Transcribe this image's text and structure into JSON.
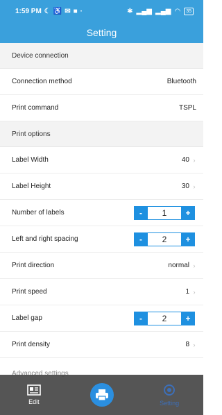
{
  "status": {
    "time": "1:59 PM",
    "battery": "35"
  },
  "app_bar": {
    "title": "Setting"
  },
  "sections": {
    "device": "Device connection",
    "print": "Print options",
    "advanced": "Advanced settings"
  },
  "rows": {
    "connection_method": {
      "label": "Connection method",
      "value": "Bluetooth"
    },
    "print_command": {
      "label": "Print command",
      "value": "TSPL"
    },
    "label_width": {
      "label": "Label Width",
      "value": "40"
    },
    "label_height": {
      "label": "Label Height",
      "value": "30"
    },
    "number_of_labels": {
      "label": "Number of labels",
      "value": "1",
      "minus": "-",
      "plus": "+"
    },
    "lr_spacing": {
      "label": "Left and right spacing",
      "value": "2",
      "minus": "-",
      "plus": "+"
    },
    "print_direction": {
      "label": "Print direction",
      "value": "normal"
    },
    "print_speed": {
      "label": "Print speed",
      "value": "1"
    },
    "label_gap": {
      "label": "Label gap",
      "value": "2",
      "minus": "-",
      "plus": "+"
    },
    "print_density": {
      "label": "Print density",
      "value": "8"
    }
  },
  "tabs": {
    "edit": "Edit",
    "setting": "Setting"
  },
  "colors": {
    "accent": "#3aa0dc",
    "stepper": "#1e90e0"
  }
}
